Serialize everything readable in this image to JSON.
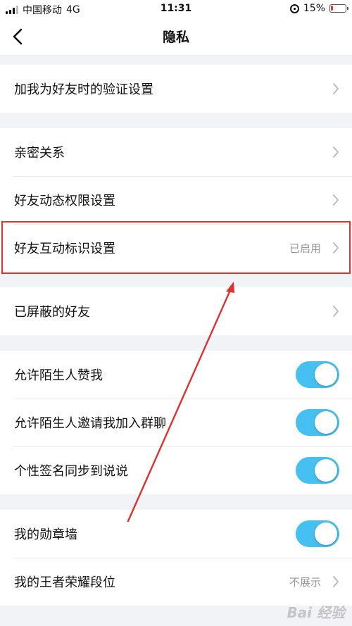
{
  "status_bar": {
    "carrier": "中国移动",
    "network": "4G",
    "time": "11:31",
    "battery_percent": "15%",
    "battery_level": 0.15
  },
  "nav": {
    "title": "隐私"
  },
  "groups": {
    "verification": {
      "label": "加我为好友时的验证设置"
    },
    "relations": {
      "intimate": "亲密关系",
      "feed_permission": "好友动态权限设置",
      "interaction_badge": "好友互动标识设置",
      "interaction_badge_value": "已启用"
    },
    "blocked": {
      "label": "已屏蔽的好友"
    },
    "toggles": {
      "allow_stranger_like": "允许陌生人赞我",
      "allow_stranger_invite": "允许陌生人邀请我加入群聊",
      "signature_sync": "个性签名同步到说说",
      "allow_stranger_like_on": true,
      "allow_stranger_invite_on": true,
      "signature_sync_on": true
    },
    "honors": {
      "medal_wall": "我的勋章墙",
      "medal_wall_on": true,
      "king_rank": "我的王者荣耀段位",
      "king_rank_value": "不展示"
    }
  },
  "watermark": "Bai 经验",
  "colors": {
    "toggle_on": "#46c0f0",
    "highlight": "#e0312f",
    "background": "#f2f3f7"
  }
}
